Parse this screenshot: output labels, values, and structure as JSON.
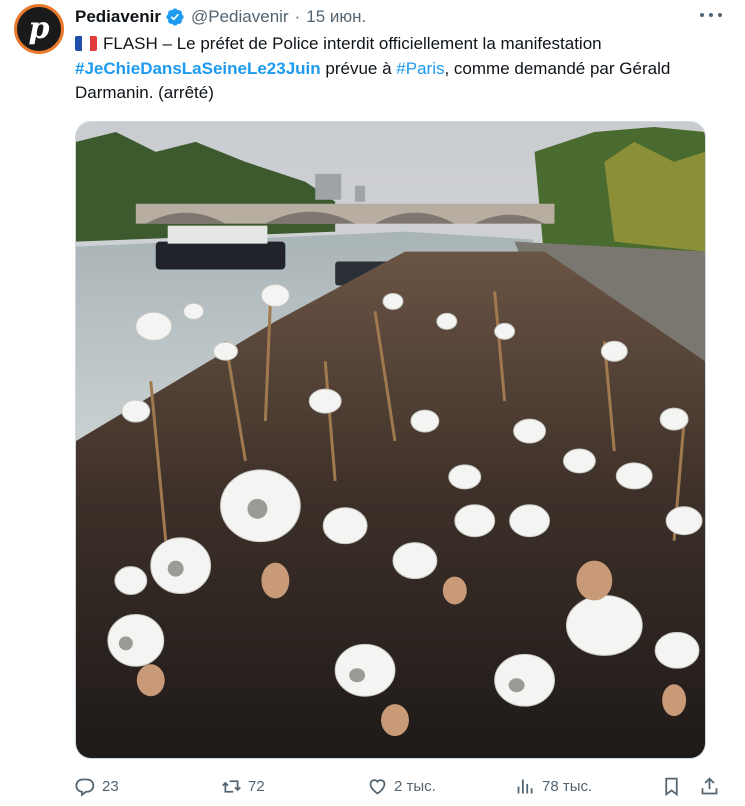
{
  "account": {
    "display_name": "Pediavenir",
    "handle": "@Pediavenir",
    "separator": "·",
    "time": "15 июн.",
    "avatar_letter": "p"
  },
  "tweet": {
    "line1_prefix": "FLASH – Le préfet de Police interdit officiellement la manifestation",
    "hashtag_main": "#JeChieDansLaSeineLe23Juin",
    "mid_text": " prévue à ",
    "hashtag_city": "#Paris",
    "tail_text": ", comme demandé par Gérald Darmanin. (arrêté)"
  },
  "media": {
    "alt": "AI-generated crowd holding toilet paper rolls along the Seine"
  },
  "actions": {
    "reply": "23",
    "retweet": "72",
    "like": "2 тыс.",
    "views": "78 тыс."
  },
  "icons": [
    "verified-badge-icon",
    "more-icon",
    "reply-icon",
    "retweet-icon",
    "like-icon",
    "views-icon",
    "bookmark-icon",
    "share-icon",
    "flag-france-icon"
  ],
  "colors": {
    "hashtag": "#1d9bf0",
    "verified": "#1d9bf0",
    "secondary_text": "#536471",
    "avatar_ring": "#e8792b"
  }
}
